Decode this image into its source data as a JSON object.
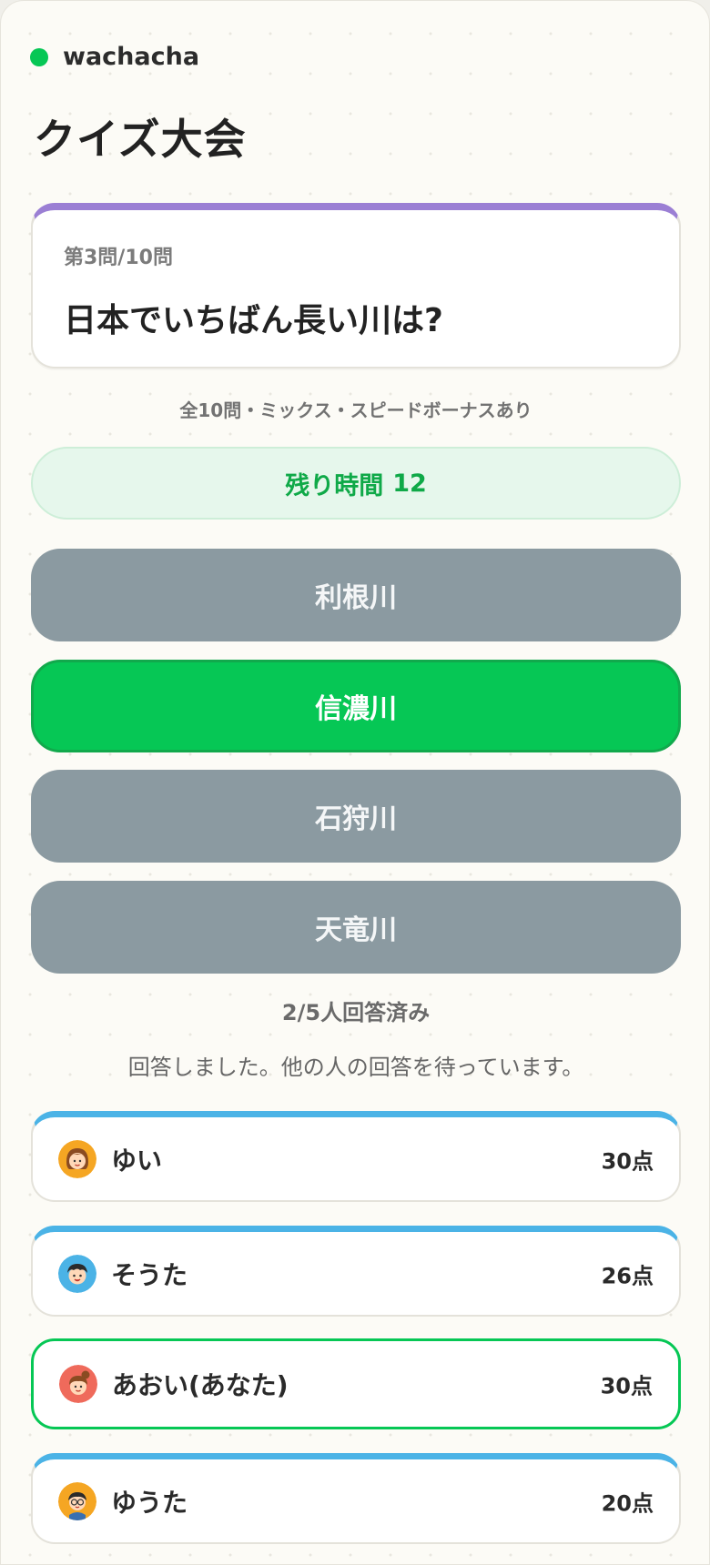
{
  "brand": {
    "name": "wachacha",
    "dot_color": "#06c755"
  },
  "page": {
    "title": "クイズ大会"
  },
  "question": {
    "progress": "第3問/10問",
    "text": "日本でいちばん長い川は?",
    "accent_color": "#9b7fd4"
  },
  "quiz_info": "全10問・ミックス・スピードボーナスあり",
  "timer": {
    "label": "残り時間",
    "value": "12",
    "color": "#0fa948"
  },
  "choices": [
    {
      "label": "利根川",
      "selected": false
    },
    {
      "label": "信濃川",
      "selected": true
    },
    {
      "label": "石狩川",
      "selected": false
    },
    {
      "label": "天竜川",
      "selected": false
    }
  ],
  "status": {
    "answered": "2/5人回答済み",
    "message": "回答しました。他の人の回答を待っています。"
  },
  "players": [
    {
      "name": "ゆい",
      "score": "30点",
      "avatar": "girl-avatar-icon",
      "avatar_color": "#f5a623"
    },
    {
      "name": "そうた",
      "score": "26点",
      "avatar": "boy-avatar-icon",
      "avatar_color": "#4bb3e6"
    },
    {
      "name": "あおい(あなた)",
      "score": "30点",
      "avatar": "girl-avatar-icon",
      "avatar_color": "#ef6a5b",
      "is_me": true
    },
    {
      "name": "ゆうた",
      "score": "20点",
      "avatar": "boy-glasses-avatar-icon",
      "avatar_color": "#f5a623"
    }
  ],
  "colors": {
    "accent": "#06c755",
    "choice_default": "#8b9aa1",
    "player_stripe": "#4bb3e6",
    "background": "#fcfbf6"
  }
}
